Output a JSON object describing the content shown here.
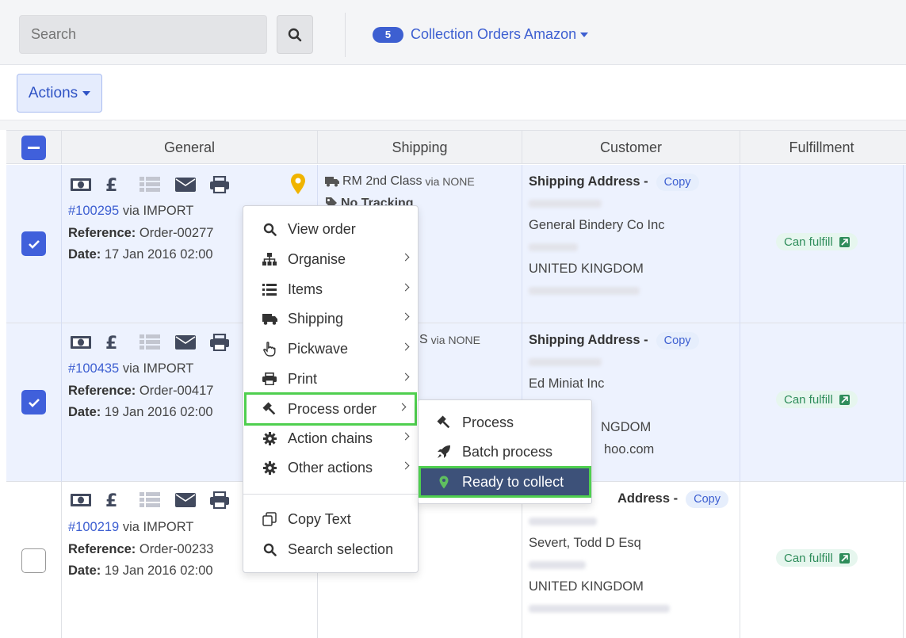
{
  "search": {
    "placeholder": "Search"
  },
  "collection": {
    "count": "5",
    "label": "Collection Orders Amazon"
  },
  "actions_label": "Actions",
  "columns": [
    "General",
    "Shipping",
    "Customer",
    "Fulfillment"
  ],
  "orders": [
    {
      "selected": true,
      "order_id": "#100295",
      "via": "via IMPORT",
      "reference_label": "Reference:",
      "reference": "Order-00277",
      "date_label": "Date:",
      "date": "17 Jan 2016 02:00",
      "shipping_service": "RM 2nd Class",
      "shipping_via": "via NONE",
      "tracking": "No Tracking",
      "shipping_address_label": "Shipping Address -",
      "copy_label": "Copy",
      "company": "General Bindery Co Inc",
      "country": "UNITED KINGDOM",
      "email_partial": "",
      "fulfillment": "Can fulfill"
    },
    {
      "selected": true,
      "order_id": "#100435",
      "via": "via IMPORT",
      "reference_label": "Reference:",
      "reference": "Order-00417",
      "date_label": "Date:",
      "date": "19 Jan 2016 02:00",
      "shipping_service": "S",
      "shipping_via": "via NONE",
      "shipping_address_label": "Shipping Address -",
      "copy_label": "Copy",
      "company": "Ed Miniat Inc",
      "country": "NGDOM",
      "email_partial": "hoo.com",
      "fulfillment": "Can fulfill"
    },
    {
      "selected": false,
      "order_id": "#100219",
      "via": "via IMPORT",
      "reference_label": "Reference:",
      "reference": "Order-00233",
      "date_label": "Date:",
      "date": "19 Jan 2016 02:00",
      "shipping_address_label": "Address -",
      "copy_label": "Copy",
      "company": "Severt, Todd D Esq",
      "country": "UNITED KINGDOM",
      "fulfillment": "Can fulfill"
    }
  ],
  "context_menu": {
    "items": [
      {
        "label": "View order",
        "icon": "search-icon"
      },
      {
        "label": "Organise",
        "icon": "sitemap-icon",
        "submenu": true
      },
      {
        "label": "Items",
        "icon": "list-icon",
        "submenu": true
      },
      {
        "label": "Shipping",
        "icon": "truck-icon",
        "submenu": true
      },
      {
        "label": "Pickwave",
        "icon": "hand-pointer-icon",
        "submenu": true
      },
      {
        "label": "Print",
        "icon": "printer-icon",
        "submenu": true
      },
      {
        "label": "Process order",
        "icon": "gavel-icon",
        "submenu": true,
        "highlighted": true
      },
      {
        "label": "Action chains",
        "icon": "gear-icon",
        "submenu": true
      },
      {
        "label": "Other actions",
        "icon": "gear-icon",
        "submenu": true
      },
      {
        "label": "Copy Text",
        "icon": "copy-icon"
      },
      {
        "label": "Search selection",
        "icon": "search-icon"
      }
    ]
  },
  "process_submenu": {
    "items": [
      {
        "label": "Process",
        "icon": "gavel-icon"
      },
      {
        "label": "Batch process",
        "icon": "rocket-icon"
      },
      {
        "label": "Ready to collect",
        "icon": "map-pin-icon",
        "active": true
      }
    ]
  },
  "colors": {
    "accent": "#3d5fd1",
    "selected_row": "#edf2fe",
    "highlight_outline": "#4fcf4f",
    "active_item": "#3d5179",
    "fulfill_green": "#2f8d5b",
    "pin_yellow": "#f0b400"
  }
}
